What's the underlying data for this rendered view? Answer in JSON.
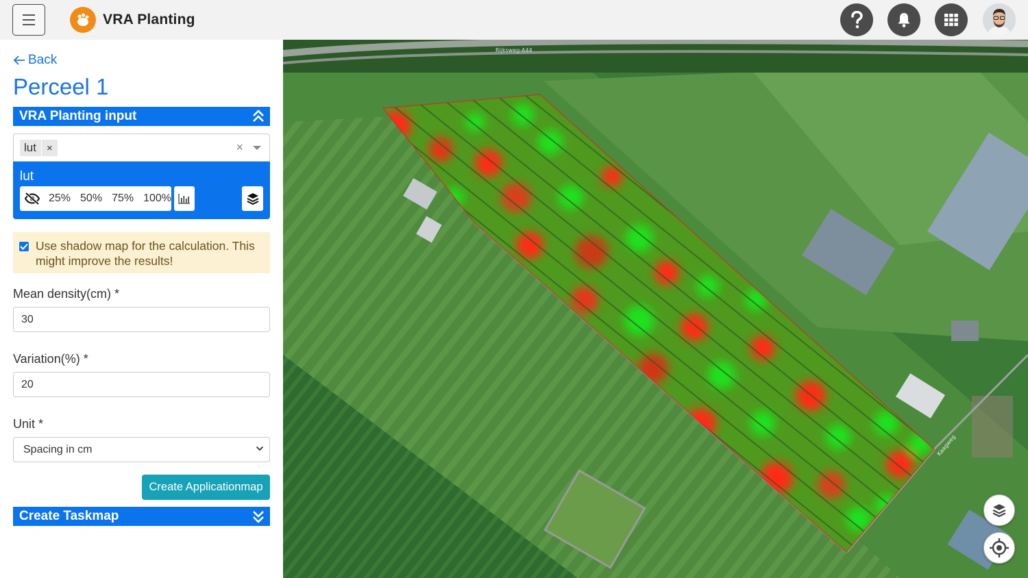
{
  "header": {
    "app_title": "VRA Planting",
    "icons": [
      "hamburger-icon",
      "logo-icon",
      "help-icon",
      "bell-icon",
      "apps-grid-icon",
      "user-avatar"
    ]
  },
  "panel": {
    "back_label": "Back",
    "title": "Perceel 1",
    "input_section": {
      "label": "VRA Planting input",
      "selected_chip": "lut",
      "clear_symbol": "×",
      "layer": {
        "name": "lut",
        "opacity_options": [
          "25%",
          "50%",
          "75%",
          "100%"
        ]
      }
    },
    "shadow_map": {
      "checked": true,
      "label": "Use shadow map for the calculation. This might improve the results!"
    },
    "mean_density": {
      "label": "Mean density(cm) *",
      "value": "30"
    },
    "variation": {
      "label": "Variation(%) *",
      "value": "20"
    },
    "unit": {
      "label": "Unit *",
      "selected": "Spacing in cm"
    },
    "create_button": "Create Applicationmap",
    "taskmap_section": {
      "label": "Create Taskmap"
    }
  },
  "map": {
    "road_label": "Rijksweg-A44",
    "side_road_label": "Kaagweg",
    "controls": [
      "layers-icon",
      "locate-icon"
    ]
  },
  "colors": {
    "accent_blue": "#0b74ec",
    "teal_button": "#17a2b8",
    "notice_bg": "#fdf1d4",
    "logo_orange": "#f28a17",
    "heat_low": "#ff2a12",
    "heat_high": "#1fe21a"
  }
}
